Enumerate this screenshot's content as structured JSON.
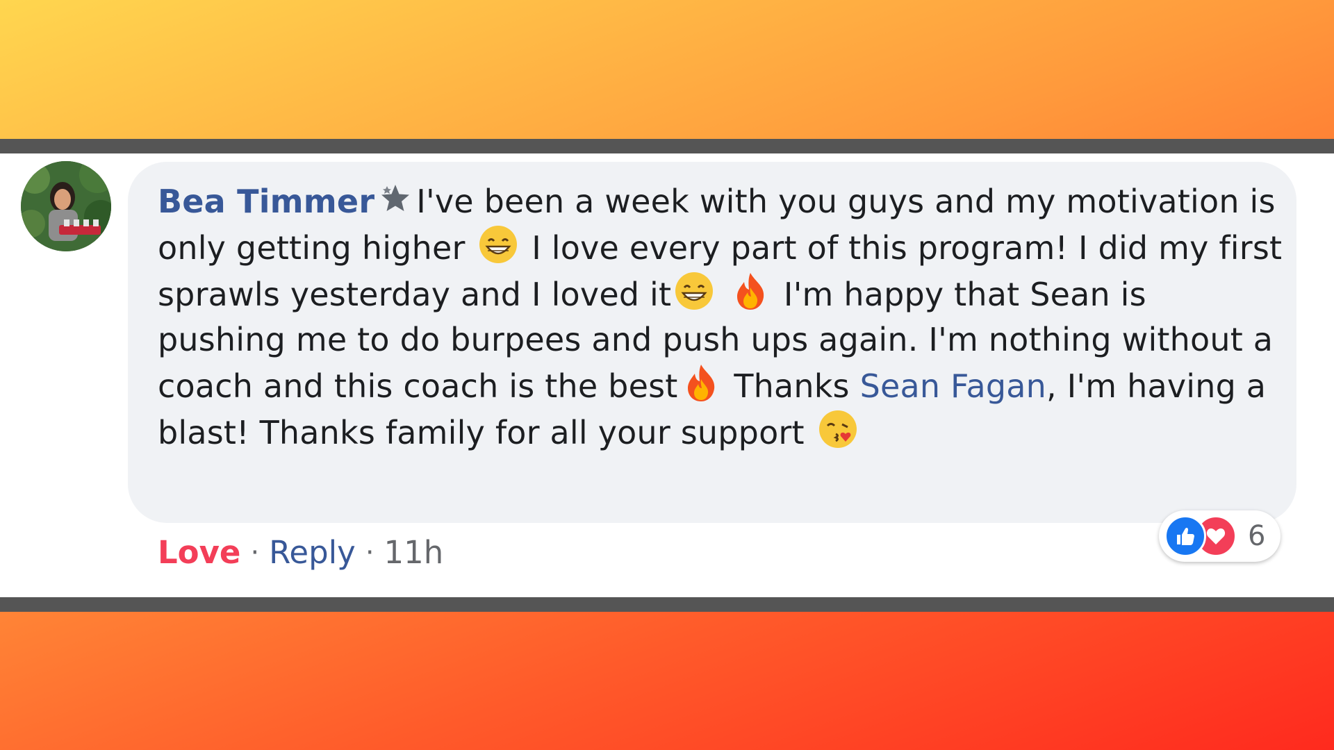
{
  "comment": {
    "author": "Bea Timmer",
    "badge_icon": "top-fan-star-icon",
    "segments": {
      "s1": "I've been a week with you guys and my motivation is only getting higher",
      "s2": "I love every part of this program! I did my first sprawls yesterday and I loved it",
      "s3": "I'm happy that Sean is pushing me to do burpees and push ups again. I'm nothing without a coach and this coach is the best",
      "s4": "Thanks",
      "mention": "Sean Fagan",
      "s5": ", I'm having a blast! Thanks family for all your support"
    },
    "emojis": [
      "grinning-face-emoji",
      "fire-emoji",
      "kissing-face-emoji"
    ]
  },
  "reactions": {
    "icons": [
      "like-icon",
      "love-icon"
    ],
    "count": "6"
  },
  "actions": {
    "love_label": "Love",
    "reply_label": "Reply",
    "separator": "·",
    "timestamp": "11h"
  },
  "colors": {
    "author_link": "#385898",
    "love_red": "#f33e58",
    "like_blue": "#1877f2",
    "bubble_bg": "#f0f2f5",
    "divider": "#555555"
  }
}
